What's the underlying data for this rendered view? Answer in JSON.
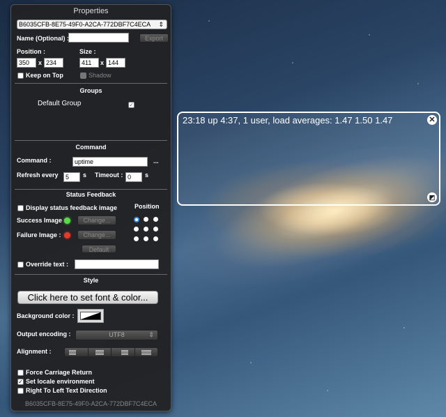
{
  "panel": {
    "title": "Properties",
    "uuid_select": "B6035CFB-8E75-49F0-A2CA-772DBF7C4ECA",
    "name_label": "Name (Optional) :",
    "name_value": "",
    "export_label": "Export",
    "position_label": "Position :",
    "pos_x": "350",
    "pos_y": "234",
    "size_label": "Size :",
    "size_w": "411",
    "size_h": "144",
    "x_sep": "x",
    "keep_on_top_label": "Keep on Top",
    "keep_on_top_checked": false,
    "shadow_label": "Shadow",
    "groups_header": "Groups",
    "group_name": "Default Group",
    "group_checked": true,
    "command_header": "Command",
    "command_label": "Command :",
    "command_value": "uptime",
    "ellipsis": "...",
    "refresh_label": "Refresh every",
    "refresh_value": "5",
    "refresh_unit": "s",
    "timeout_label": "Timeout :",
    "timeout_value": "0",
    "timeout_unit": "s",
    "status_header": "Status Feedback",
    "display_status_label": "Display status feedback image",
    "position_header": "Position",
    "success_label": "Success Image :",
    "failure_label": "Failure Image :",
    "change_label": "Change...",
    "default_label": "Default",
    "override_label": "Override text :",
    "override_value": "",
    "style_header": "Style",
    "font_button": "Click here to set font & color...",
    "bg_color_label": "Background color :",
    "encoding_label": "Output encoding :",
    "encoding_value": "UTF8",
    "alignment_label": "Alignment :",
    "force_cr_label": "Force Carriage Return",
    "locale_label": "Set locale environment",
    "rtl_label": "Right To Left Text Direction",
    "footer_uuid": "B6035CFB-8E75-49F0-A2CA-772DBF7C4ECA"
  },
  "widget": {
    "text": "23:18  up  4:37, 1 user, load averages: 1.47 1.50 1.47",
    "close_glyph": "✕",
    "resize_glyph": "◩"
  },
  "colors": {
    "success_led": "#5bd94a",
    "failure_led": "#e33a2a",
    "radio_selected": "#3a8ee8"
  }
}
